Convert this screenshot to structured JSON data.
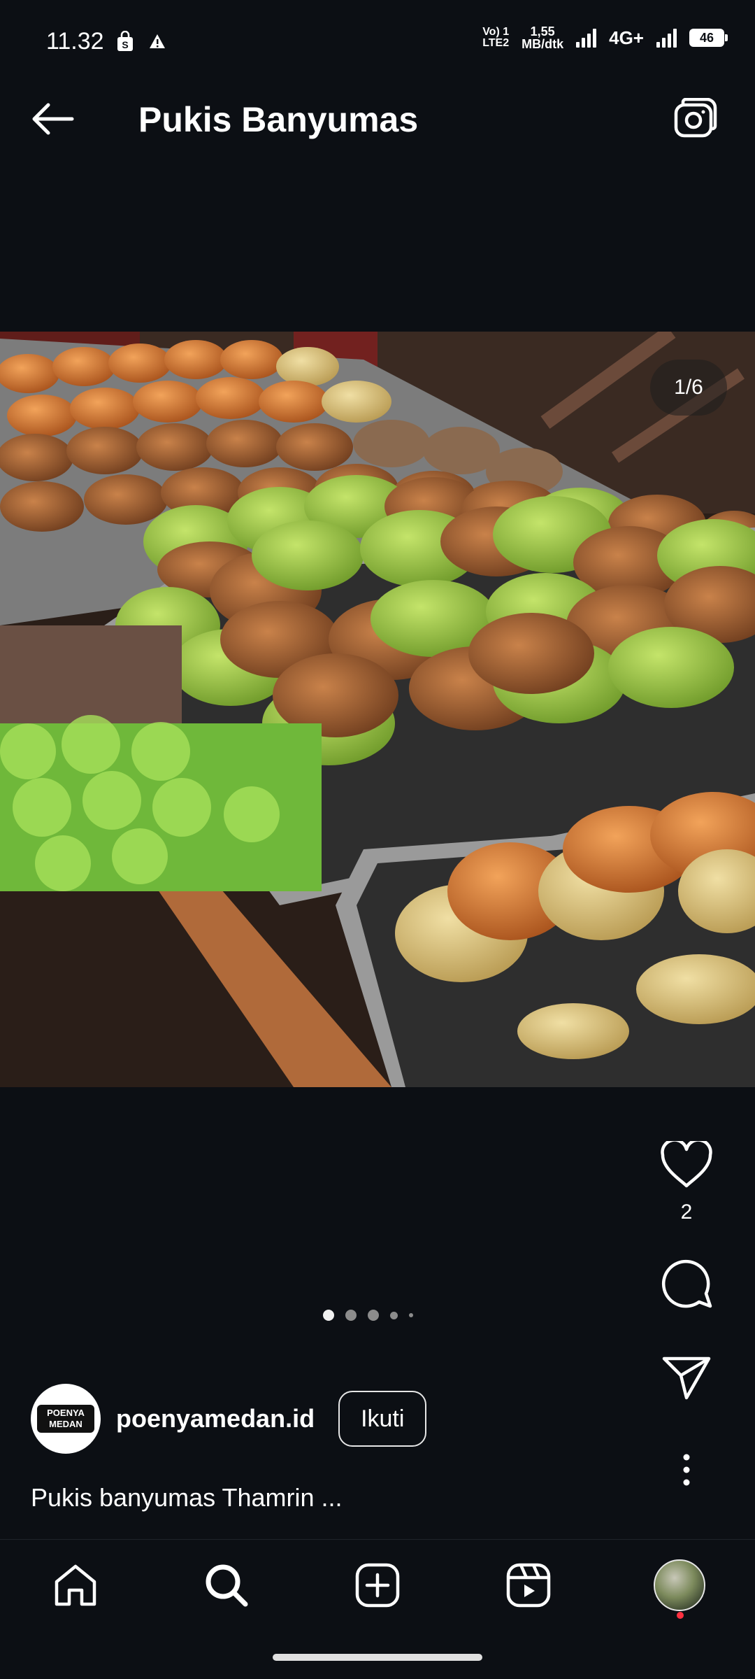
{
  "status_bar": {
    "time": "11.32",
    "volte_top": "Vo) 1",
    "volte_bottom": "LTE2",
    "speed_value": "1,55",
    "speed_unit": "MB/dtk",
    "network_type": "4G+",
    "battery_level": "46"
  },
  "header": {
    "title": "Pukis Banyumas",
    "back_icon": "arrow-left-icon",
    "camera_icon": "camera-icon"
  },
  "photo": {
    "counter": "1/6",
    "description_icon": "food-photo"
  },
  "actions": {
    "like_count": "2"
  },
  "carousel": {
    "total": 6,
    "current": 1
  },
  "post": {
    "avatar_text_line1": "POENYA",
    "avatar_text_line2": "MEDAN",
    "username": "poenyamedan.id",
    "follow_label": "Ikuti",
    "caption": "Pukis banyumas Thamrin ..."
  },
  "colors": {
    "background": "#0c0f14",
    "text": "#ffffff",
    "notif": "#ff3040"
  }
}
